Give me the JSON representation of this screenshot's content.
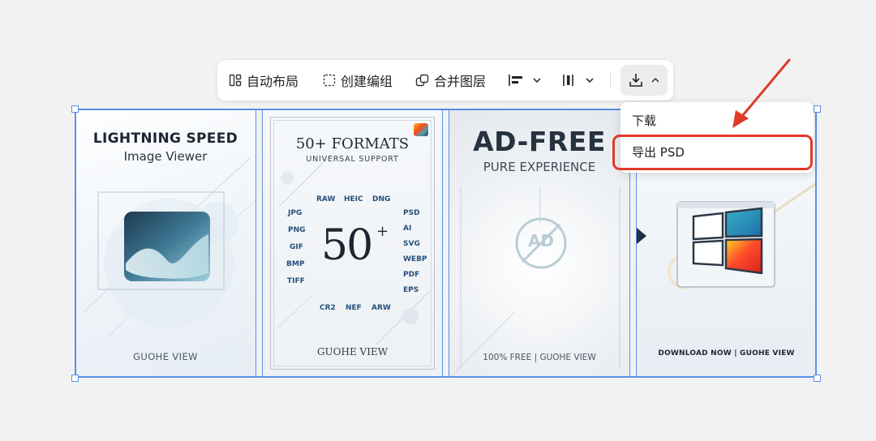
{
  "toolbar": {
    "auto_layout": "自动布局",
    "create_group": "创建编组",
    "merge_layers": "合并图层"
  },
  "panels": {
    "p1": {
      "title": "LIGHTNING SPEED",
      "subtitle": "Image Viewer",
      "footer": "GUOHE VIEW"
    },
    "p2": {
      "title": "50+ FORMATS",
      "subtitle": "UNIVERSAL SUPPORT",
      "big_number": "50",
      "big_plus": "+",
      "formats_top": [
        "RAW",
        "HEIC",
        "DNG"
      ],
      "formats_left": [
        "JPG",
        "PNG",
        "GIF",
        "BMP",
        "TIFF"
      ],
      "formats_right": [
        "PSD",
        "AI",
        "SVG",
        "WEBP",
        "PDF",
        "EPS"
      ],
      "formats_bottom": [
        "CR2",
        "NEF",
        "ARW"
      ],
      "footer": "GUOHE VIEW"
    },
    "p3": {
      "title": "AD-FREE",
      "subtitle": "PURE EXPERIENCE",
      "ad_mark": "AD",
      "footer": "100% FREE |  GUOHE VIEW"
    },
    "p4": {
      "footer": "DOWNLOAD NOW | GUOHE VIEW"
    }
  },
  "menu": {
    "download": "下载",
    "export_psd": "导出 PSD"
  },
  "colors": {
    "selection": "#5b8fe6",
    "highlight": "#e03a2a",
    "accent_blue": "#25507a"
  }
}
